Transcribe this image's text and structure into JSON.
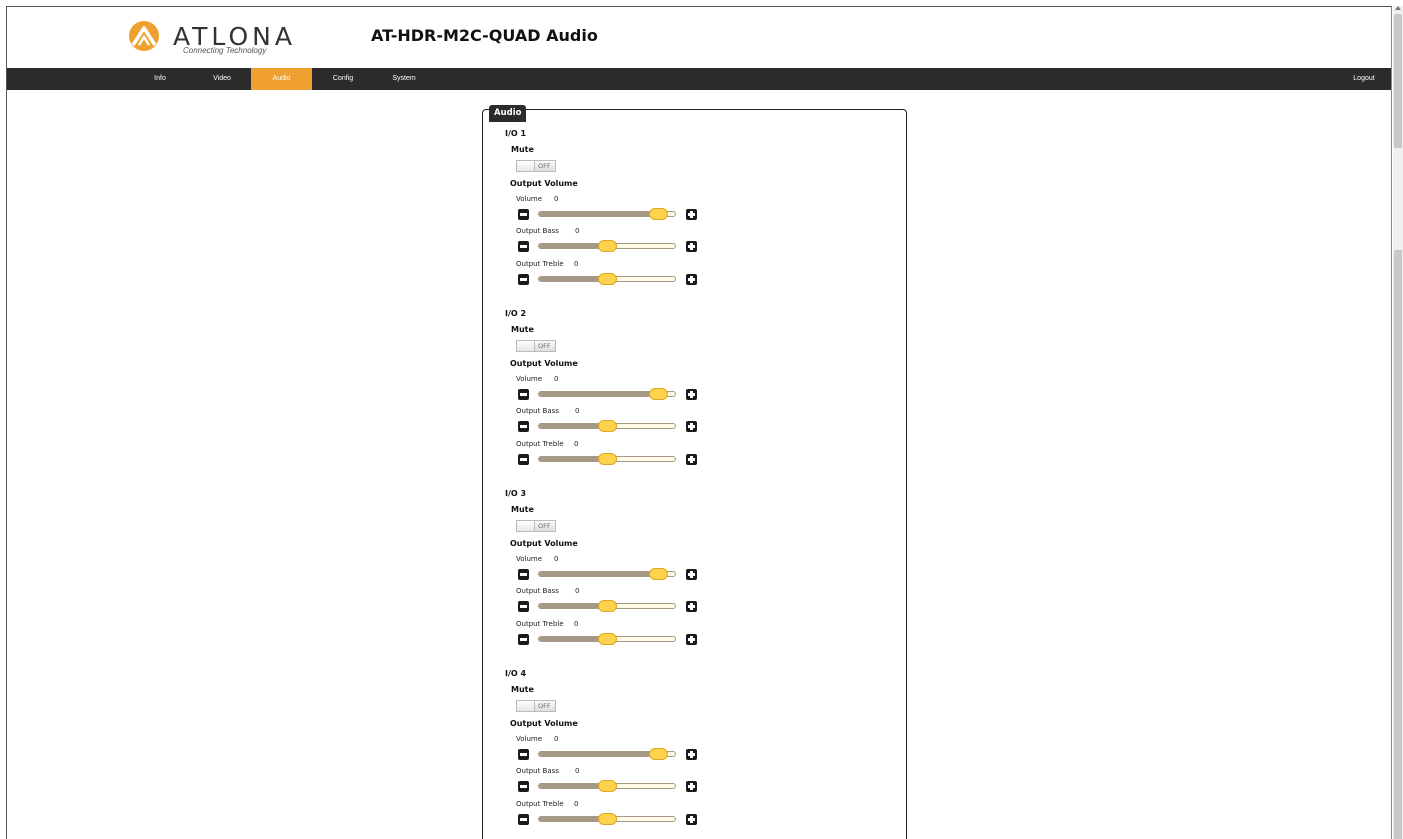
{
  "brand": {
    "name": "ATLONA",
    "tagline": "Connecting Technology",
    "accent": "#f0a030"
  },
  "header": {
    "title": "AT-HDR-M2C-QUAD  Audio"
  },
  "nav": {
    "items": [
      {
        "label": "Info",
        "active": false
      },
      {
        "label": "Video",
        "active": false
      },
      {
        "label": "Audio",
        "active": true
      },
      {
        "label": "Config",
        "active": false
      },
      {
        "label": "System",
        "active": false
      }
    ],
    "logout": "Logout"
  },
  "panel": {
    "title": "Audio",
    "ios": [
      {
        "name": "I/O 1",
        "mute_label": "Mute",
        "mute_state": "OFF",
        "output_volume_label": "Output Volume",
        "volume": {
          "label": "Volume",
          "value": "0",
          "level": 0.94
        },
        "bass": {
          "label": "Output Bass",
          "value": "0",
          "level": 0.5
        },
        "treble": {
          "label": "Output Treble",
          "value": "0",
          "level": 0.5
        }
      },
      {
        "name": "I/O 2",
        "mute_label": "Mute",
        "mute_state": "OFF",
        "output_volume_label": "Output Volume",
        "volume": {
          "label": "Volume",
          "value": "0",
          "level": 0.94
        },
        "bass": {
          "label": "Output Bass",
          "value": "0",
          "level": 0.5
        },
        "treble": {
          "label": "Output Treble",
          "value": "0",
          "level": 0.5
        }
      },
      {
        "name": "I/O 3",
        "mute_label": "Mute",
        "mute_state": "OFF",
        "output_volume_label": "Output Volume",
        "volume": {
          "label": "Volume",
          "value": "0",
          "level": 0.94
        },
        "bass": {
          "label": "Output Bass",
          "value": "0",
          "level": 0.5
        },
        "treble": {
          "label": "Output Treble",
          "value": "0",
          "level": 0.5
        }
      },
      {
        "name": "I/O 4",
        "mute_label": "Mute",
        "mute_state": "OFF",
        "output_volume_label": "Output Volume",
        "volume": {
          "label": "Volume",
          "value": "0",
          "level": 0.94
        },
        "bass": {
          "label": "Output Bass",
          "value": "0",
          "level": 0.5
        },
        "treble": {
          "label": "Output Treble",
          "value": "0",
          "level": 0.5
        }
      }
    ]
  }
}
